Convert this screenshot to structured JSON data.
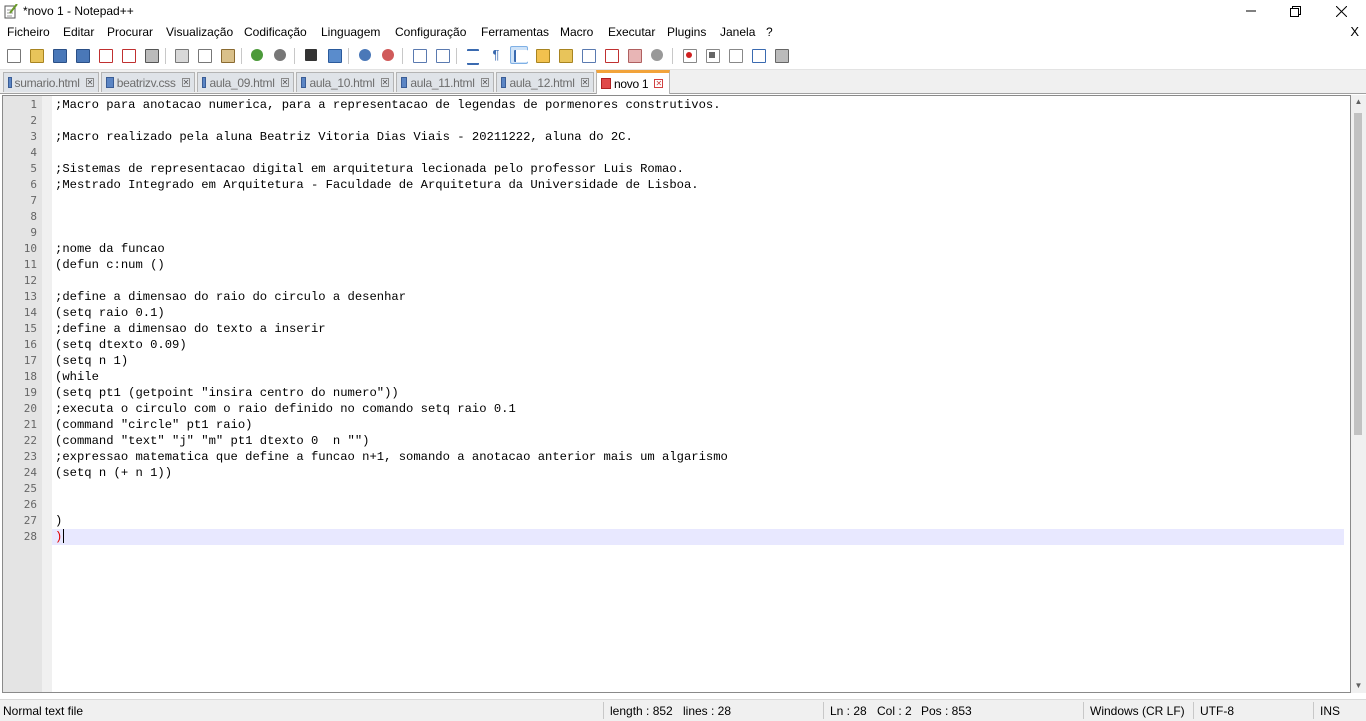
{
  "window": {
    "title": "*novo 1 - Notepad++"
  },
  "menu": {
    "items": [
      "Ficheiro",
      "Editar",
      "Procurar",
      "Visualização",
      "Codificação",
      "Linguagem",
      "Configuração",
      "Ferramentas",
      "Macro",
      "Executar",
      "Plugins",
      "Janela",
      "?"
    ],
    "close_label": "X"
  },
  "toolbar": {
    "buttons": [
      "new-file",
      "open-file",
      "save",
      "save-all",
      "close",
      "close-all",
      "print",
      "cut",
      "copy",
      "paste",
      "undo",
      "redo",
      "find",
      "replace",
      "zoom-in",
      "zoom-out",
      "sync-vertical",
      "sync-horizontal",
      "word-wrap",
      "show-all-characters",
      "indent-guide",
      "function-list",
      "folder-as-workspace",
      "document-map",
      "monitoring",
      "start-recording",
      "stop-recording",
      "playback",
      "run-multiple",
      "save-macro"
    ]
  },
  "tabs": [
    {
      "label": "sumario.html",
      "state": "saved",
      "active": false
    },
    {
      "label": "beatrizv.css",
      "state": "saved",
      "active": false
    },
    {
      "label": "aula_09.html",
      "state": "saved",
      "active": false
    },
    {
      "label": "aula_10.html",
      "state": "saved",
      "active": false
    },
    {
      "label": "aula_11.html",
      "state": "saved",
      "active": false
    },
    {
      "label": "aula_12.html",
      "state": "saved",
      "active": false
    },
    {
      "label": "novo 1",
      "state": "unsaved",
      "active": true
    }
  ],
  "editor": {
    "current_line": 28,
    "lines": [
      ";Macro para anotacao numerica, para a representacao de legendas de pormenores construtivos.",
      "",
      ";Macro realizado pela aluna Beatriz Vitoria Dias Viais - 20211222, aluna do 2C.",
      "",
      ";Sistemas de representacao digital em arquitetura lecionada pelo professor Luis Romao.",
      ";Mestrado Integrado em Arquitetura - Faculdade de Arquitetura da Universidade de Lisboa.",
      "",
      "",
      "",
      ";nome da funcao",
      "(defun c:num ()",
      "",
      ";define a dimensao do raio do circulo a desenhar",
      "(setq raio 0.1)",
      ";define a dimensao do texto a inserir",
      "(setq dtexto 0.09)",
      "(setq n 1)",
      "(while",
      "(setq pt1 (getpoint \"insira centro do numero\"))",
      ";executa o circulo com o raio definido no comando setq raio 0.1",
      "(command \"circle\" pt1 raio)",
      "(command \"text\" \"j\" \"m\" pt1 dtexto 0  n \"\")",
      ";expressao matematica que define a funcao n+1, somando a anotacao anterior mais um algarismo",
      "(setq n (+ n 1))",
      "",
      "",
      ")",
      ")"
    ]
  },
  "status": {
    "file_type": "Normal text file",
    "length": "length : 852",
    "lines": "lines : 28",
    "ln": "Ln : 28",
    "col": "Col : 2",
    "pos": "Pos : 853",
    "eol": "Windows (CR LF)",
    "encoding": "UTF-8",
    "mode": "INS"
  },
  "colors": {
    "active_tab_accent": "#f2a33a",
    "current_line": "#e8e8ff",
    "unmatched_brace": "#e00000"
  }
}
